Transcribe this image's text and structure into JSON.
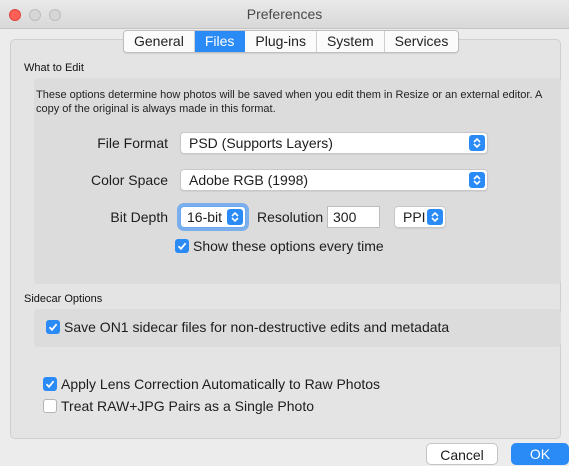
{
  "window": {
    "title": "Preferences"
  },
  "tabs": [
    {
      "label": "General"
    },
    {
      "label": "Files"
    },
    {
      "label": "Plug-ins"
    },
    {
      "label": "System"
    },
    {
      "label": "Services"
    }
  ],
  "what_to_edit": {
    "heading": "What to Edit",
    "description": "These options determine how photos will be saved when you edit them in Resize or an external editor.  A copy of the original is always made in this format.",
    "file_format": {
      "label": "File Format",
      "value": "PSD (Supports Layers)"
    },
    "color_space": {
      "label": "Color Space",
      "value": "Adobe RGB (1998)"
    },
    "bit_depth": {
      "label": "Bit Depth",
      "value": "16-bit"
    },
    "resolution": {
      "label": "Resolution",
      "value": "300",
      "unit": "PPI"
    },
    "show_options": {
      "label": "Show these options every time",
      "checked": true
    }
  },
  "sidecar": {
    "heading": "Sidecar Options",
    "save_sidecar": {
      "label": "Save ON1 sidecar files for non-destructive edits and metadata",
      "checked": true
    }
  },
  "raw": {
    "lens_correction": {
      "label": "Apply Lens Correction Automatically to Raw Photos",
      "checked": true
    },
    "raw_jpg_pairs": {
      "label": "Treat RAW+JPG Pairs as a Single Photo",
      "checked": false
    }
  },
  "buttons": {
    "cancel": "Cancel",
    "ok": "OK"
  },
  "colors": {
    "accent": "#2a8bf7",
    "close": "#fe5f57"
  }
}
